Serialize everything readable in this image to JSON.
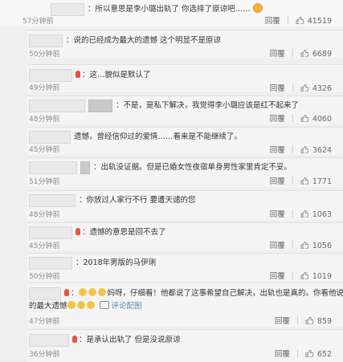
{
  "comments": [
    {
      "text": "：所以意思是李小璐出轨了 你选择了原谅吧……",
      "time": "57分钟前",
      "reply": "回覆",
      "likes": "41519"
    },
    {
      "text": "：说的已经成为最大的遗憾 这个明显不是原谅",
      "time": "50分钟前",
      "reply": "回覆",
      "likes": "6689"
    },
    {
      "text": "：这…貌似是默认了",
      "time": "49分钟前",
      "reply": "回覆",
      "likes": "4326"
    },
    {
      "text": "：不是，是私下解决，我觉得李小璐应该是红不起来了",
      "time": "48分钟前",
      "reply": "回覆",
      "likes": "4060"
    },
    {
      "text": "遗憾，曾经信仰过的爱情……看来是不能继续了。",
      "time": "45分钟前",
      "reply": "回覆",
      "likes": "3624"
    },
    {
      "text": "：出轨没证据。但是已婚女性夜宿单身男性家里肯定不妥。",
      "time": "51分钟前",
      "reply": "回覆",
      "likes": "1771"
    },
    {
      "text": "：你放过人家行不行 要遭天谴的您",
      "time": "48分钟前",
      "reply": "回覆",
      "likes": "1063"
    },
    {
      "text": "：遗憾的意思是回不去了",
      "time": "45分钟前",
      "reply": "回覆",
      "likes": "1056"
    },
    {
      "text": "：2018年男版的马伊琍",
      "time": "50分钟前",
      "reply": "回覆",
      "likes": "1019"
    },
    {
      "text_line1": "：",
      "text_line1b": "妈呀，仔细看！他都说了这事希望自己解决，出轨也是真的。你看他说",
      "text_line2": "的最大遗憾",
      "comment_link": "评论配图",
      "time": "47分钟前",
      "reply": "回覆",
      "likes": "859"
    },
    {
      "text": "：是承认出轨了 但是没说原谅",
      "time": "36分钟前",
      "reply": "回覆",
      "likes": "652"
    }
  ],
  "colors": {
    "link": "#5b87b8",
    "muted": "#8a8a8a",
    "emoji": "#f2c24a"
  },
  "icons": {
    "like": "thumb-up-icon",
    "emoji": "smile-emoji-icon"
  }
}
